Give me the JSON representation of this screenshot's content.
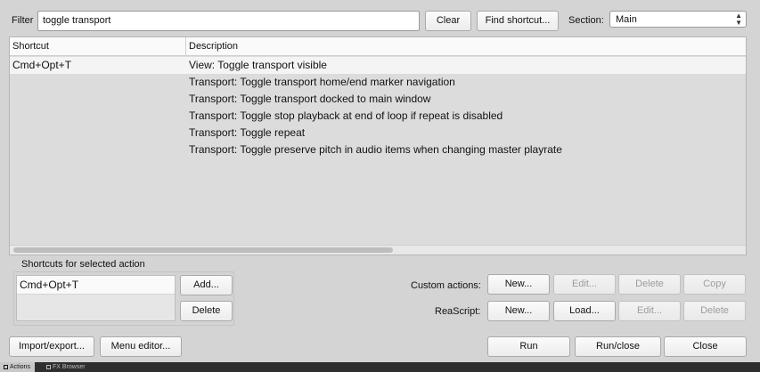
{
  "filter": {
    "label": "Filter",
    "value": "toggle transport"
  },
  "buttons": {
    "clear": "Clear",
    "find_shortcut": "Find shortcut..."
  },
  "section": {
    "label": "Section:",
    "value": "Main"
  },
  "table": {
    "columns": [
      "Shortcut",
      "Description"
    ],
    "rows": [
      {
        "shortcut": "Cmd+Opt+T",
        "description": "View: Toggle transport visible"
      },
      {
        "shortcut": "",
        "description": "Transport: Toggle transport home/end marker navigation"
      },
      {
        "shortcut": "",
        "description": "Transport: Toggle transport docked to main window"
      },
      {
        "shortcut": "",
        "description": "Transport: Toggle stop playback at end of loop if repeat is disabled"
      },
      {
        "shortcut": "",
        "description": "Transport: Toggle repeat"
      },
      {
        "shortcut": "",
        "description": "Transport: Toggle preserve pitch in audio items when changing master playrate"
      }
    ]
  },
  "shortcuts_panel": {
    "title": "Shortcuts for selected action",
    "items": [
      "Cmd+Opt+T"
    ],
    "add": "Add...",
    "delete": "Delete"
  },
  "custom_actions": {
    "label": "Custom actions:",
    "new": "New...",
    "edit": "Edit...",
    "delete": "Delete",
    "copy": "Copy"
  },
  "reascript": {
    "label": "ReaScript:",
    "new": "New...",
    "load": "Load...",
    "edit": "Edit...",
    "delete": "Delete"
  },
  "footer": {
    "import_export": "Import/export...",
    "menu_editor": "Menu editor...",
    "run": "Run",
    "run_close": "Run/close",
    "close": "Close"
  },
  "dock_tabs": [
    "Actions",
    "FX Browser"
  ],
  "icons": {
    "select_chevron": "updown-chevron-icon",
    "dock_tab": "window-icon"
  }
}
